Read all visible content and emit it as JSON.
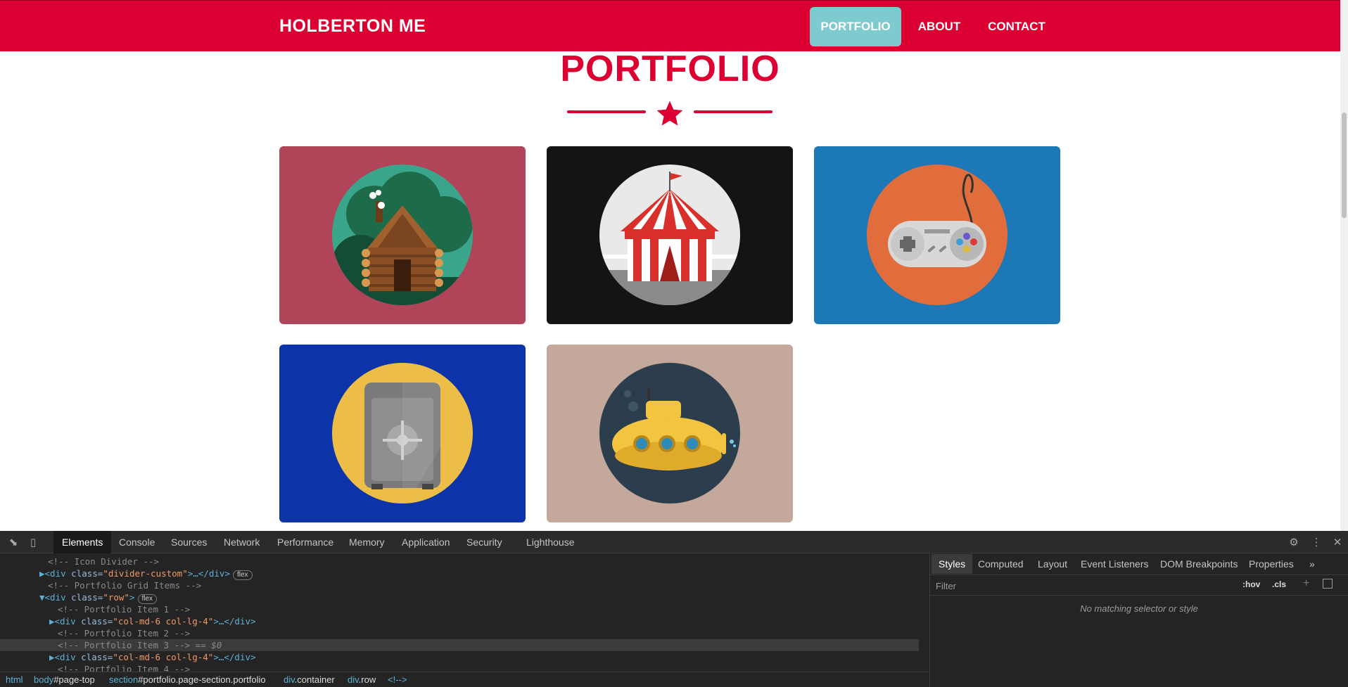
{
  "navbar": {
    "brand": "HOLBERTON ME",
    "items": [
      {
        "label": "PORTFOLIO",
        "active": true
      },
      {
        "label": "ABOUT",
        "active": false
      },
      {
        "label": "CONTACT",
        "active": false
      }
    ]
  },
  "portfolio": {
    "title": "PORTFOLIO",
    "divider_icon": "star-icon",
    "items": [
      {
        "name": "cabin",
        "bg_color": "#b0455a"
      },
      {
        "name": "circus-tent",
        "bg_color": "#141414"
      },
      {
        "name": "game-controller",
        "bg_color": "#1d78b8"
      },
      {
        "name": "safe",
        "bg_color": "#0d33a8"
      },
      {
        "name": "submarine",
        "bg_color": "#c4a89b"
      }
    ]
  },
  "devtools": {
    "tabs": [
      "Elements",
      "Console",
      "Sources",
      "Network",
      "Performance",
      "Memory",
      "Application",
      "Security",
      "Lighthouse"
    ],
    "active_tab": "Elements",
    "dom_lines": [
      {
        "text": "<!-- Icon Divider -->"
      },
      {
        "tag_open": "<div ",
        "attr": "class=",
        "val": "\"divider-custom\"",
        "rest": ">…</div>",
        "badge": "flex"
      },
      {
        "text": "<!-- Portfolio Grid Items -->"
      },
      {
        "tag_open": "<div ",
        "attr": "class=",
        "val": "\"row\"",
        "rest": ">",
        "badge": "flex"
      },
      {
        "text": "<!-- Portfolio Item 1 -->"
      },
      {
        "tag_open": "<div ",
        "attr": "class=",
        "val": "\"col-md-6 col-lg-4\"",
        "rest": ">…</div>"
      },
      {
        "text": "<!-- Portfolio Item 2 -->"
      },
      {
        "text": "<!-- Portfolio Item 3 -->",
        "suffix": " == $0"
      },
      {
        "tag_open": "<div ",
        "attr": "class=",
        "val": "\"col-md-6 col-lg-4\"",
        "rest": ">…</div>"
      },
      {
        "text": "<!-- Portfolio Item 4 -->"
      }
    ],
    "breadcrumb": [
      {
        "tag": "html",
        "ident": ""
      },
      {
        "tag": "body",
        "ident": "#page-top"
      },
      {
        "tag": "section",
        "ident": "#portfolio.page-section.portfolio"
      },
      {
        "tag": "div",
        "ident": ".container"
      },
      {
        "tag": "div",
        "ident": ".row"
      },
      {
        "tag": "<!--",
        "ident": ">"
      }
    ],
    "styles_tabs": [
      "Styles",
      "Computed",
      "Layout",
      "Event Listeners",
      "DOM Breakpoints",
      "Properties"
    ],
    "filter_placeholder": "Filter",
    "hov_label": ":hov",
    "cls_label": ".cls",
    "no_match": "No matching selector or style"
  }
}
